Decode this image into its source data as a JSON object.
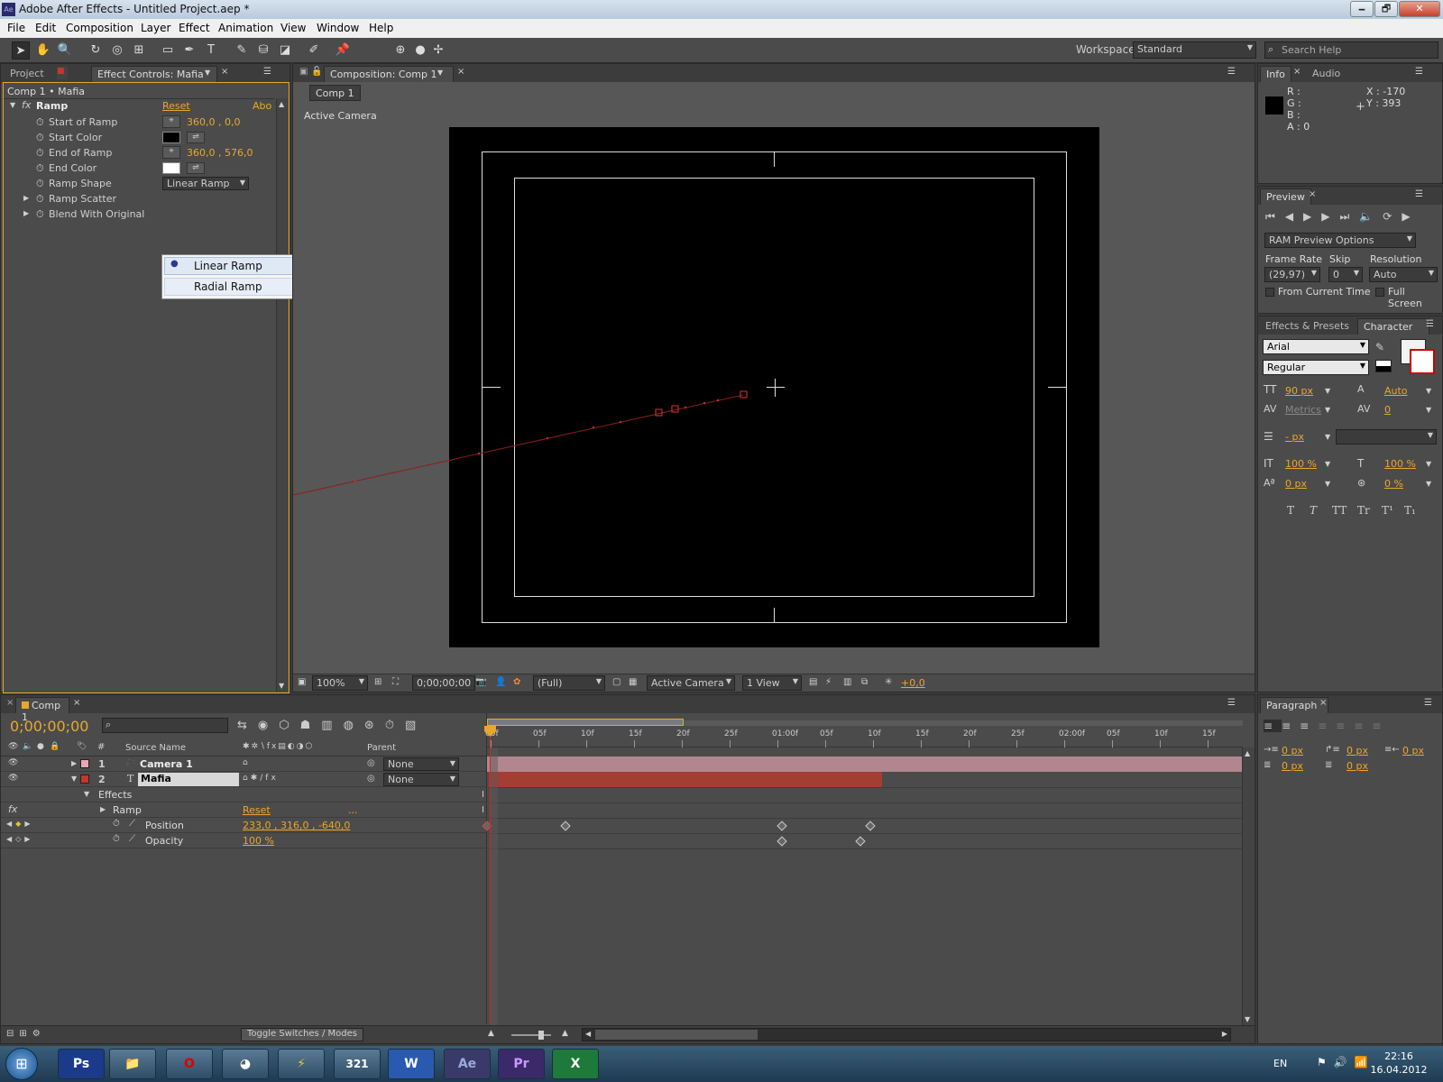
{
  "window": {
    "title": "Adobe After Effects - Untitled Project.aep *",
    "logo": "Ae",
    "minimize": "🗕",
    "maximize": "🗗",
    "close": "✕"
  },
  "menu": [
    "File",
    "Edit",
    "Composition",
    "Layer",
    "Effect",
    "Animation",
    "View",
    "Window",
    "Help"
  ],
  "toolbar": {
    "workspace_label": "Workspace:",
    "workspace_value": "Standard",
    "search_placeholder": "Search Help"
  },
  "effect_panel": {
    "tabs": [
      "Project",
      "Effect Controls: Mafia"
    ],
    "breadcrumb": "Comp 1 • Mafia",
    "effect_name": "Ramp",
    "reset": "Reset",
    "about": "About...",
    "properties": [
      {
        "label": "Start of Ramp",
        "value": "360,0 ,  0,0"
      },
      {
        "label": "Start Color",
        "value": ""
      },
      {
        "label": "End of Ramp",
        "value": "360,0 ,  576,0"
      },
      {
        "label": "End Color",
        "value": ""
      },
      {
        "label": "Ramp Shape",
        "value": "Linear Ramp"
      },
      {
        "label": "Ramp Scatter",
        "value": ""
      },
      {
        "label": "Blend With Original",
        "value": ""
      }
    ],
    "popup": [
      "Linear Ramp",
      "Radial Ramp"
    ]
  },
  "comp_panel": {
    "tab": "Composition: Comp 1",
    "subtab": "Comp 1",
    "camera_label": "Active Camera",
    "zoom": "100%",
    "timecode": "0;00;00;00",
    "resolution": "(Full)",
    "view": "Active Camera",
    "views": "1 View",
    "exposure": "+0,0"
  },
  "info_panel": {
    "tabs": [
      "Info",
      "Audio"
    ],
    "rgba": [
      "R :",
      "G :",
      "B :",
      "A : 0"
    ],
    "xy": [
      "X : -170",
      "Y : 393"
    ]
  },
  "preview_panel": {
    "tab": "Preview",
    "ram_options": "RAM Preview Options",
    "frame_rate_label": "Frame Rate",
    "frame_rate": "(29,97)",
    "skip_label": "Skip",
    "skip": "0",
    "resolution_label": "Resolution",
    "resolution": "Auto",
    "from_current": "From Current Time",
    "full_screen": "Full Screen"
  },
  "character_panel": {
    "tabs": [
      "Effects & Presets",
      "Character"
    ],
    "font": "Arial",
    "style": "Regular",
    "size": "90 px",
    "leading": "Auto",
    "kerning": "Metrics",
    "tracking": "0",
    "stroke": "- px",
    "vscale": "100 %",
    "hscale": "100 %",
    "baseline": "0 px",
    "tsume": "0 %",
    "styles": [
      "T",
      "T",
      "TT",
      "Tr",
      "T¹",
      "T₁"
    ]
  },
  "paragraph_panel": {
    "tab": "Paragraph",
    "values": [
      "0 px",
      "0 px",
      "0 px",
      "0 px",
      "0 px"
    ]
  },
  "timeline": {
    "tab": "Comp 1",
    "timecode": "0;00;00;00",
    "col_num": "#",
    "col_source": "Source Name",
    "col_parent": "Parent",
    "ruler": [
      "00f",
      "05f",
      "10f",
      "15f",
      "20f",
      "25f",
      "01:00f",
      "05f",
      "10f",
      "15f",
      "20f",
      "25f",
      "02:00f",
      "05f",
      "10f",
      "15f"
    ],
    "layers": [
      {
        "num": "1",
        "name": "Camera 1",
        "parent": "None",
        "color": "#e9a6b4"
      },
      {
        "num": "2",
        "name": "Mafia",
        "parent": "None",
        "color": "#c0392b"
      }
    ],
    "effects_label": "Effects",
    "ramp_label": "Ramp",
    "ramp_reset": "Reset",
    "ramp_dots": "...",
    "position_label": "Position",
    "position_value": "233,0 ,  316,0 ,  -640,0",
    "opacity_label": "Opacity",
    "opacity_value": "100 %",
    "toggle": "Toggle Switches / Modes"
  },
  "taskbar": {
    "apps": [
      "Ps",
      "",
      "O",
      "",
      "",
      "321",
      "W",
      "Ae",
      "Pr",
      "X"
    ],
    "lang": "EN",
    "time": "22:16",
    "date": "16.04.2012"
  }
}
